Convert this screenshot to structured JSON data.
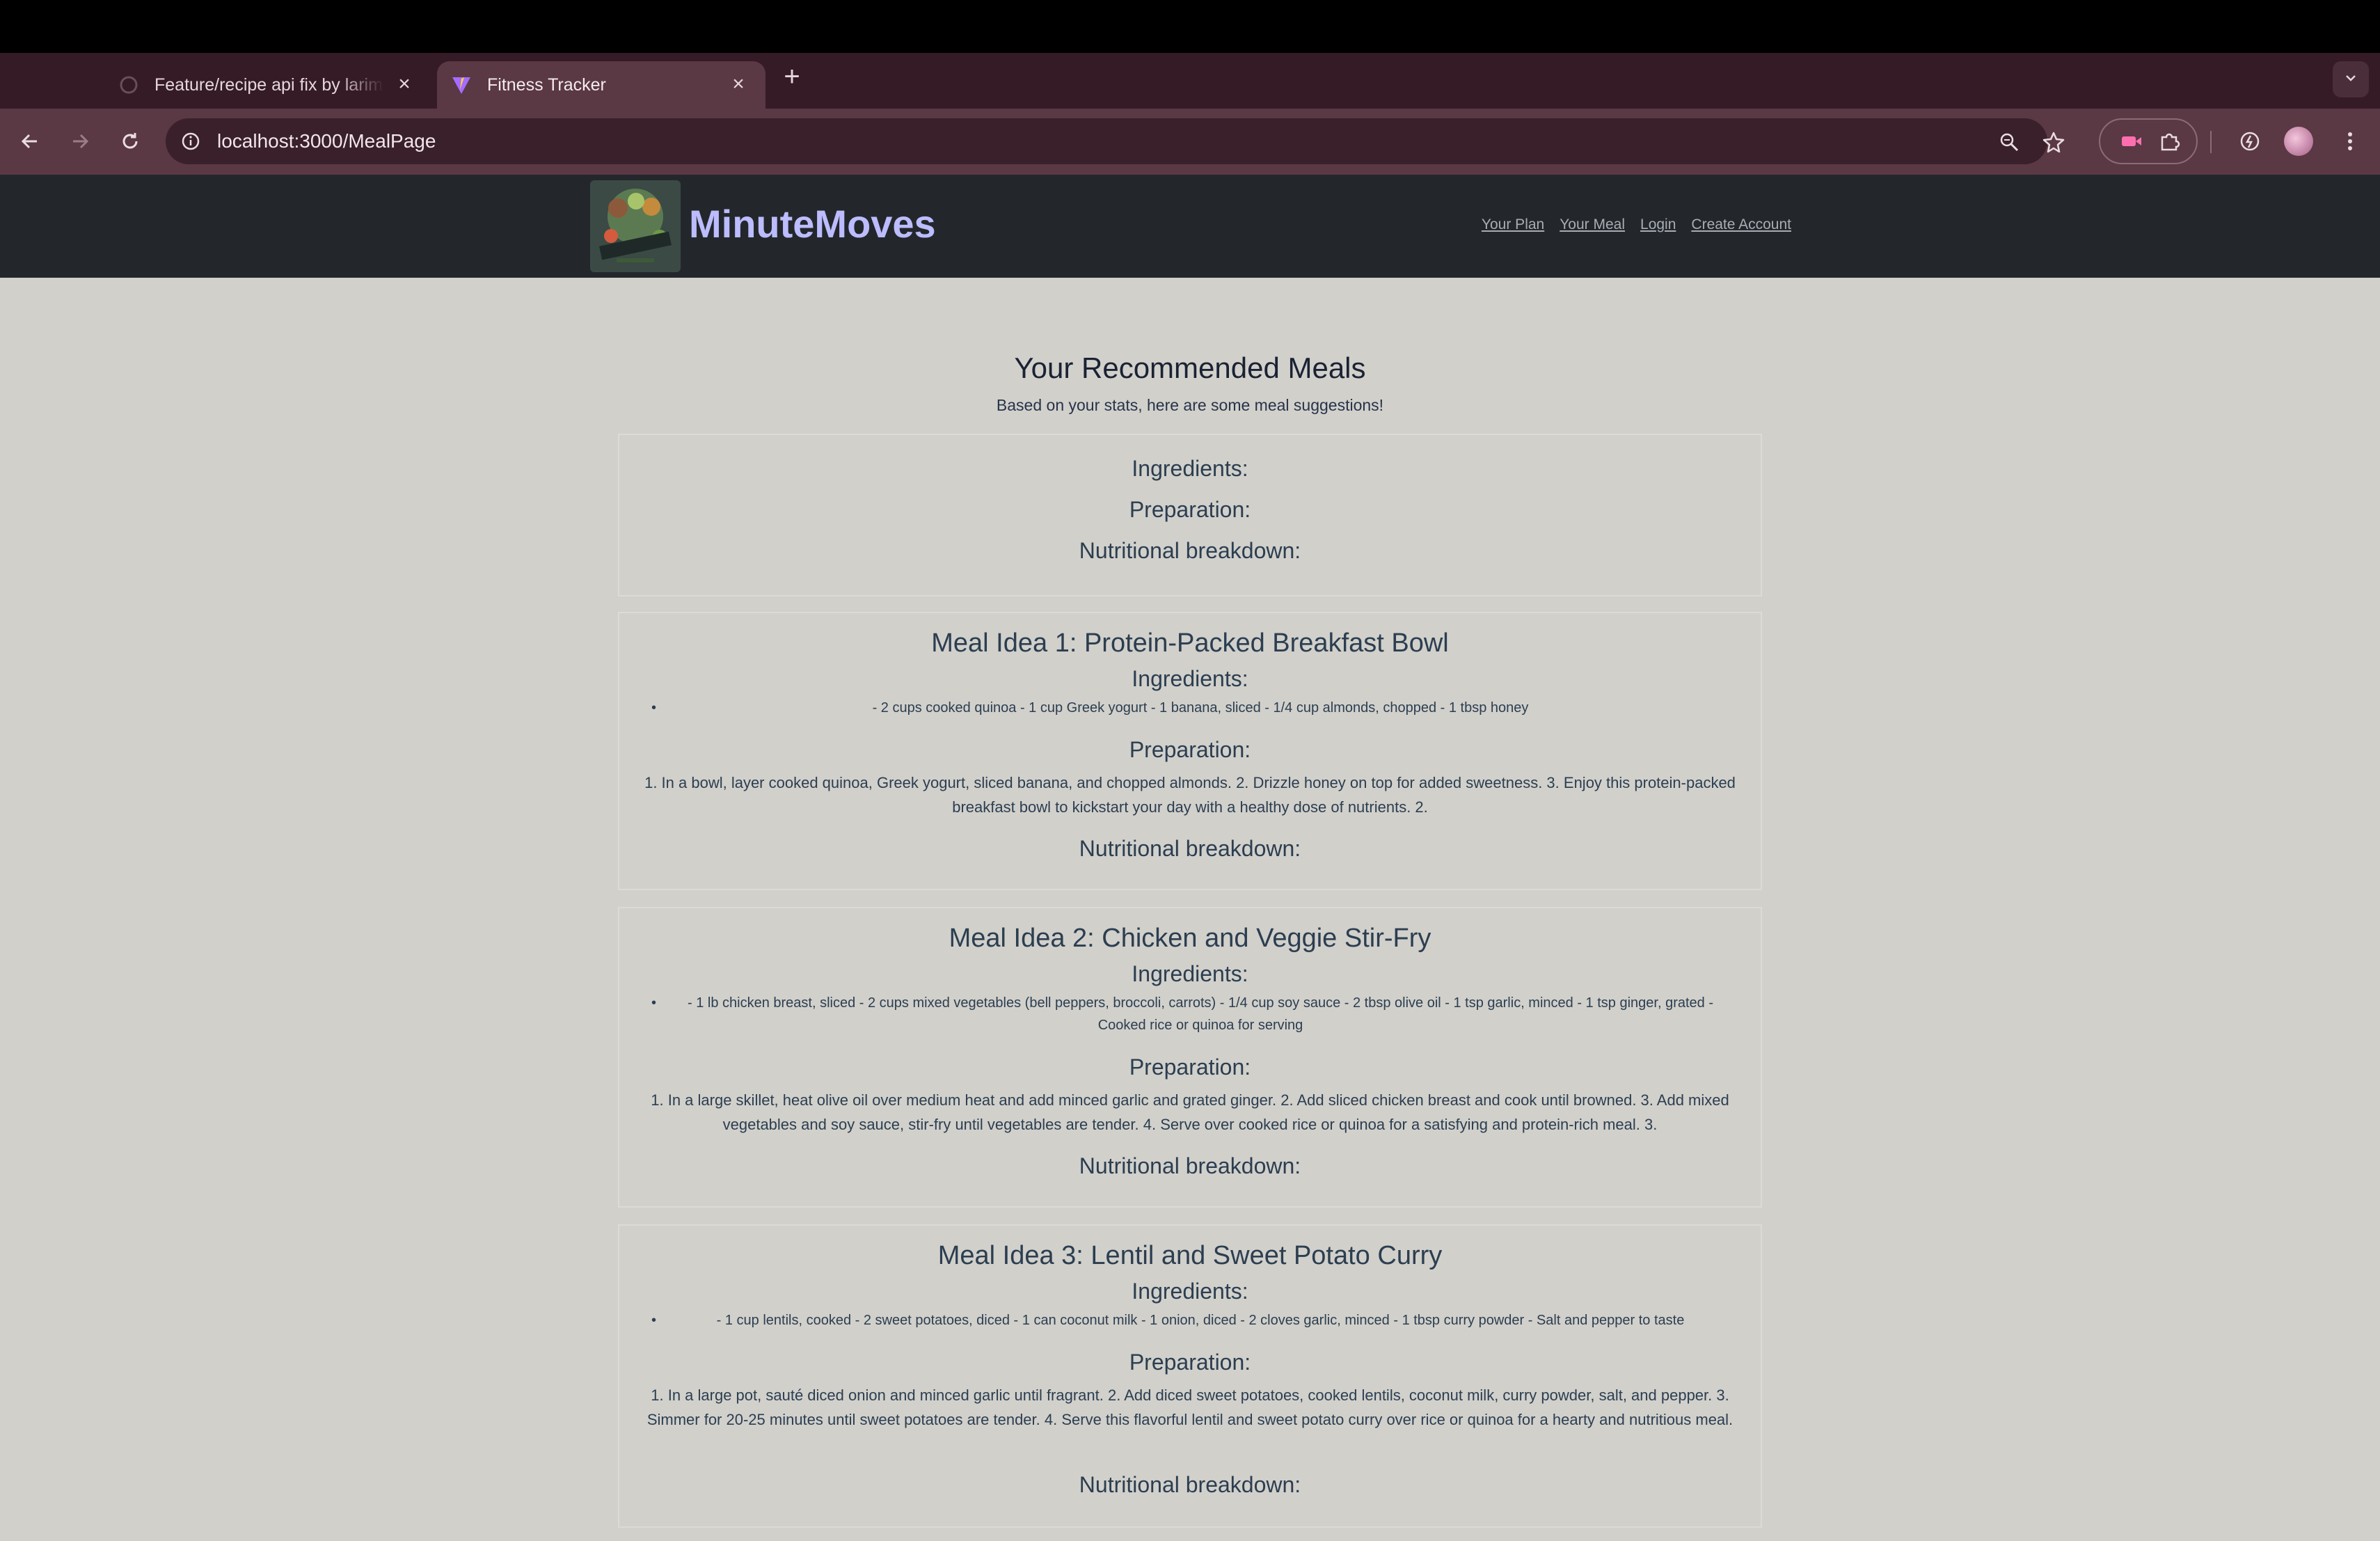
{
  "browser": {
    "tabs": [
      {
        "title": "Feature/recipe api fix by larim",
        "active": false
      },
      {
        "title": "Fitness Tracker",
        "active": true
      }
    ],
    "url": "localhost:3000/MealPage"
  },
  "site": {
    "brand": "MinuteMoves",
    "logo_text": "MINUTE MOVES",
    "nav": [
      "Your Plan",
      "Your Meal",
      "Login",
      "Create Account"
    ]
  },
  "page": {
    "title": "Your Recommended Meals",
    "subtitle": "Based on your stats, here are some meal suggestions!"
  },
  "labels": {
    "ingredients": "Ingredients:",
    "preparation": "Preparation:",
    "nutrition": "Nutritional breakdown:"
  },
  "meals": [
    {
      "title": "Meal Idea 1: Protein-Packed Breakfast Bowl",
      "ingredients": "- 2 cups cooked quinoa - 1 cup Greek yogurt - 1 banana, sliced - 1/4 cup almonds, chopped - 1 tbsp honey",
      "preparation": "1. In a bowl, layer cooked quinoa, Greek yogurt, sliced banana, and chopped almonds. 2. Drizzle honey on top for added sweetness. 3. Enjoy this protein-packed breakfast bowl to kickstart your day with a healthy dose of nutrients. 2."
    },
    {
      "title": "Meal Idea 2: Chicken and Veggie Stir-Fry",
      "ingredients": "- 1 lb chicken breast, sliced - 2 cups mixed vegetables (bell peppers, broccoli, carrots) - 1/4 cup soy sauce - 2 tbsp olive oil - 1 tsp garlic, minced - 1 tsp ginger, grated - Cooked rice or quinoa for serving",
      "preparation": "1. In a large skillet, heat olive oil over medium heat and add minced garlic and grated ginger. 2. Add sliced chicken breast and cook until browned. 3. Add mixed vegetables and soy sauce, stir-fry until vegetables are tender. 4. Serve over cooked rice or quinoa for a satisfying and protein-rich meal. 3."
    },
    {
      "title": "Meal Idea 3: Lentil and Sweet Potato Curry",
      "ingredients": "- 1 cup lentils, cooked - 2 sweet potatoes, diced - 1 can coconut milk - 1 onion, diced - 2 cloves garlic, minced - 1 tbsp curry powder - Salt and pepper to taste",
      "preparation": "1. In a large pot, sauté diced onion and minced garlic until fragrant. 2. Add diced sweet potatoes, cooked lentils, coconut milk, curry powder, salt, and pepper. 3. Simmer for 20-25 minutes until sweet potatoes are tender. 4. Serve this flavorful lentil and sweet potato curry over rice or quinoa for a hearty and nutritious meal."
    }
  ]
}
